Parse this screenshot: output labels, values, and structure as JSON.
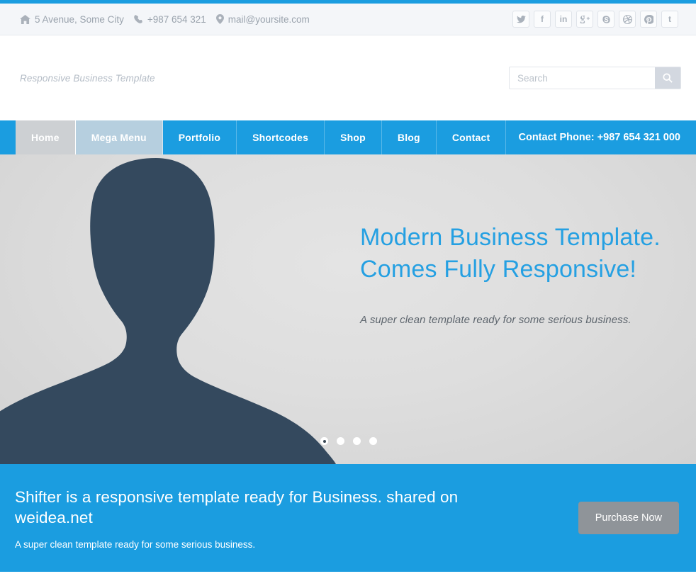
{
  "topbar": {
    "info": [
      {
        "icon": "home-icon",
        "text": "5 Avenue, Some City"
      },
      {
        "icon": "phone-icon",
        "text": "+987 654 321"
      },
      {
        "icon": "map-pin-icon",
        "text": "mail@yoursite.com"
      }
    ],
    "socials": [
      {
        "name": "twitter-icon",
        "glyph": ""
      },
      {
        "name": "facebook-icon",
        "glyph": "f"
      },
      {
        "name": "linkedin-icon",
        "glyph": "in"
      },
      {
        "name": "google-plus-icon",
        "glyph": "g+"
      },
      {
        "name": "skype-icon",
        "glyph": "S"
      },
      {
        "name": "dribbble-icon",
        "glyph": ""
      },
      {
        "name": "pinterest-icon",
        "glyph": ""
      },
      {
        "name": "tumblr-icon",
        "glyph": "t"
      }
    ]
  },
  "brand": {
    "tagline": "Responsive Business Template"
  },
  "search": {
    "value": "",
    "placeholder": "Search"
  },
  "nav": {
    "items": [
      {
        "label": "Home",
        "state": "active"
      },
      {
        "label": "Mega Menu",
        "state": "hover"
      },
      {
        "label": "Portfolio",
        "state": ""
      },
      {
        "label": "Shortcodes",
        "state": ""
      },
      {
        "label": "Shop",
        "state": ""
      },
      {
        "label": "Blog",
        "state": ""
      },
      {
        "label": "Contact",
        "state": ""
      }
    ],
    "phone": "Contact Phone: +987 654 321 000"
  },
  "hero": {
    "title_line1": "Modern Business Template.",
    "title_line2": "Comes Fully Responsive!",
    "subtitle": "A super clean template ready for some serious business.",
    "dots": [
      {
        "active": true
      },
      {
        "active": false
      },
      {
        "active": false
      },
      {
        "active": false
      }
    ]
  },
  "cta": {
    "title": "Shifter is a responsive template ready for Business. shared on weidea.net",
    "subtitle": "A super clean template ready for some serious business.",
    "button": "Purchase Now"
  },
  "colors": {
    "accent_blue": "#1b9de0",
    "hero_title_blue": "#25a0e2",
    "silhouette": "#34495e",
    "nav_active_bg": "#cdd0d3",
    "nav_hover_bg": "#b6cfdf",
    "cta_button_bg": "#8f9499",
    "topbar_bg": "#f4f6f9",
    "hero_bg": "#dedede"
  }
}
